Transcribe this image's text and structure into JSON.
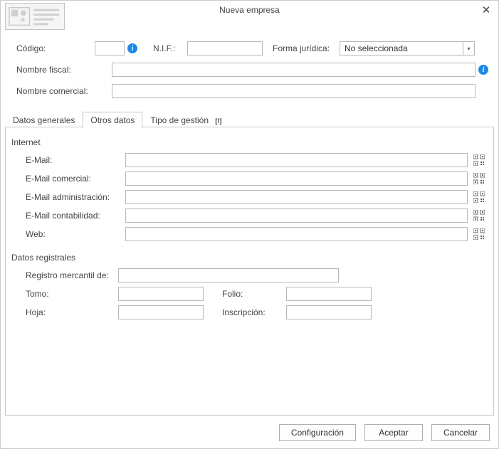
{
  "title": "Nueva empresa",
  "header": {
    "codigo_label": "Código:",
    "codigo_value": "",
    "nif_label": "N.I.F.:",
    "nif_value": "",
    "forma_label": "Forma jurídica:",
    "forma_selected": "No seleccionada",
    "nombre_fiscal_label": "Nombre fiscal:",
    "nombre_fiscal_value": "",
    "nombre_comercial_label": "Nombre comercial:",
    "nombre_comercial_value": ""
  },
  "tabs": [
    {
      "label": "Datos generales"
    },
    {
      "label": "Otros datos"
    },
    {
      "label": "Tipo de gestión",
      "badge": "[!]"
    }
  ],
  "active_tab": 1,
  "internet": {
    "title": "Internet",
    "email_label": "E-Mail:",
    "email_value": "",
    "email_com_label": "E-Mail comercial:",
    "email_com_value": "",
    "email_admin_label": "E-Mail administración:",
    "email_admin_value": "",
    "email_cont_label": "E-Mail contabilidad:",
    "email_cont_value": "",
    "web_label": "Web:",
    "web_value": ""
  },
  "registral": {
    "title": "Datos registrales",
    "registro_label": "Registro mercantil de:",
    "registro_value": "",
    "tomo_label": "Tomo:",
    "tomo_value": "",
    "folio_label": "Folio:",
    "folio_value": "",
    "hoja_label": "Hoja:",
    "hoja_value": "",
    "inscripcion_label": "Inscripción:",
    "inscripcion_value": ""
  },
  "footer": {
    "config": "Configuración",
    "accept": "Aceptar",
    "cancel": "Cancelar"
  }
}
